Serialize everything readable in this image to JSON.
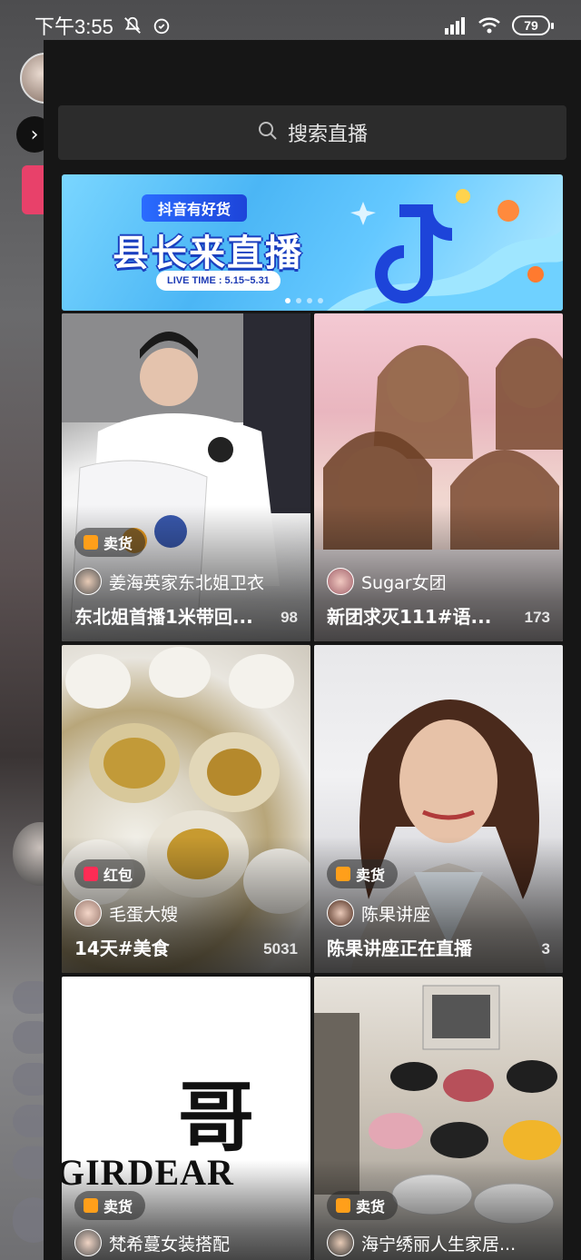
{
  "status_bar": {
    "time": "下午3:55",
    "battery": "79",
    "icons": [
      "mute-icon",
      "alarm-icon",
      "signal-icon",
      "wifi-icon",
      "battery-icon"
    ]
  },
  "search": {
    "label": "搜索直播"
  },
  "banner": {
    "tag": "抖音有好货",
    "title": "县长来直播",
    "time": "LIVE TIME : 5.15~5.31",
    "page_count": 4,
    "active_page": 1
  },
  "cards": [
    {
      "badge": "卖货",
      "badge_color": "#ff9f1a",
      "streamer": "姜海英家东北姐卫衣",
      "title": "东北姐首播1米带回...",
      "count": "98"
    },
    {
      "badge": "",
      "badge_color": "",
      "streamer": "Sugar女团",
      "title": "新团求灭111#语...",
      "count": "173"
    },
    {
      "badge": "红包",
      "badge_color": "#fe2c55",
      "streamer": "毛蛋大嫂",
      "title": "14天#美食",
      "count": "5031"
    },
    {
      "badge": "卖货",
      "badge_color": "#ff9f1a",
      "streamer": "陈果讲座",
      "title": "陈果讲座正在直播",
      "count": "3"
    },
    {
      "badge": "卖货",
      "badge_color": "#ff9f1a",
      "streamer": "梵希蔓女装搭配",
      "title": "",
      "count": ""
    },
    {
      "badge": "卖货",
      "badge_color": "#ff9f1a",
      "streamer": "海宁绣丽人生家居...",
      "title": "",
      "count": ""
    }
  ],
  "card5_image_text": {
    "brand": "GIRDEAR",
    "char": "哥"
  }
}
